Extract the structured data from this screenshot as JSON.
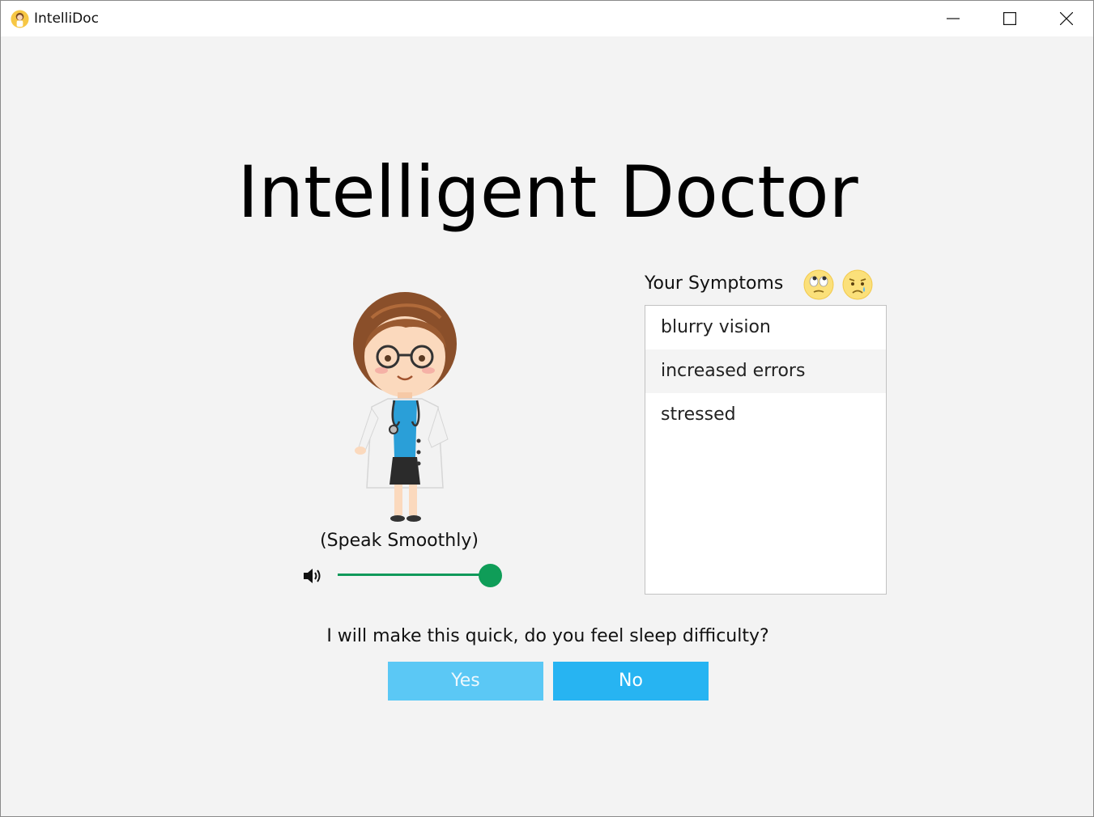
{
  "window": {
    "title": "IntelliDoc"
  },
  "header": {
    "title": "Intelligent Doctor"
  },
  "doctor": {
    "speak_label": "(Speak Smoothly)",
    "volume": 0.93
  },
  "symptoms": {
    "label": "Your Symptoms",
    "icons": [
      "eye-roll-emoji-icon",
      "crying-emoji-icon"
    ],
    "items": [
      "blurry vision",
      "increased errors",
      "stressed"
    ]
  },
  "question": {
    "text": "I will make this quick, do you feel sleep difficulty?",
    "yes_label": "Yes",
    "no_label": "No"
  },
  "colors": {
    "accent": "#27b4f2",
    "accent_light": "#5bc8f5",
    "slider": "#0f9d58"
  }
}
